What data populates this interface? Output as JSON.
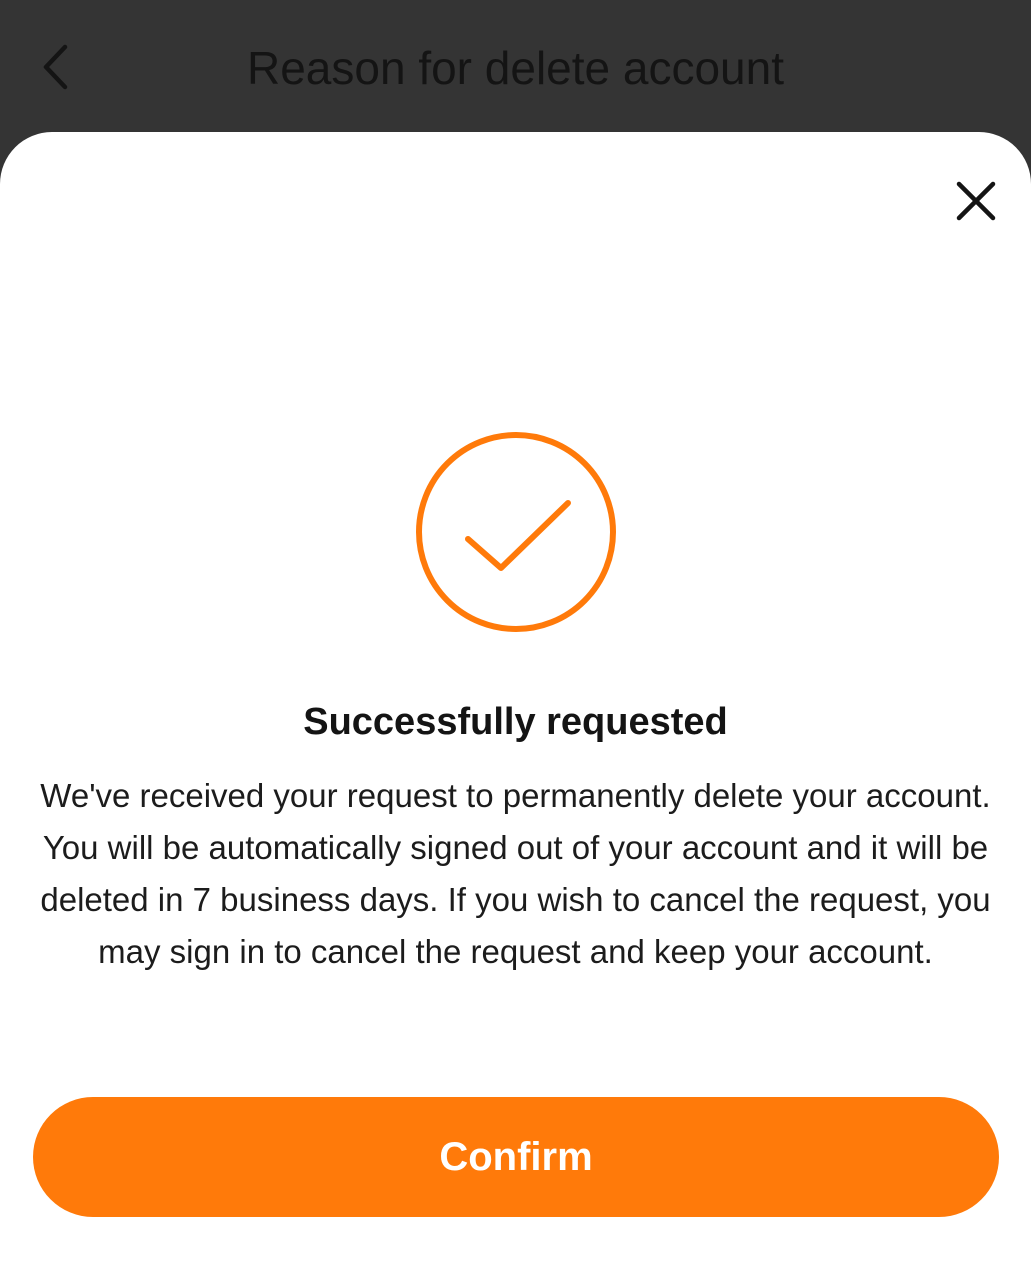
{
  "header": {
    "title": "Reason for delete account",
    "back_icon": "chevron-left-icon"
  },
  "dialog": {
    "close_icon": "close-icon",
    "status_icon": "check-circle-icon",
    "title": "Successfully requested",
    "message": "We've received your request to permanently delete your account. You will be automatically signed out of your account and it will be deleted in 7 business days. If you wish to cancel the request, you may sign in to cancel the request and keep your account.",
    "confirm_label": "Confirm"
  },
  "colors": {
    "accent": "#ff7a0a",
    "header_background": "#343434",
    "sheet_background": "#ffffff",
    "text": "#141414"
  }
}
